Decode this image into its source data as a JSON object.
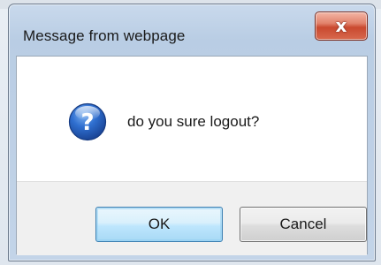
{
  "dialog": {
    "title": "Message from webpage",
    "close_glyph": "x",
    "icon": "question-icon",
    "message": "do you sure logout?",
    "buttons": {
      "ok_label": "OK",
      "cancel_label": "Cancel"
    }
  },
  "colors": {
    "titlebar": "#c3d4e8",
    "close_button": "#c9492f",
    "icon_blue": "#1f5bb5",
    "ok_border": "#3c7fb1",
    "button_area": "#f0f0f0"
  }
}
